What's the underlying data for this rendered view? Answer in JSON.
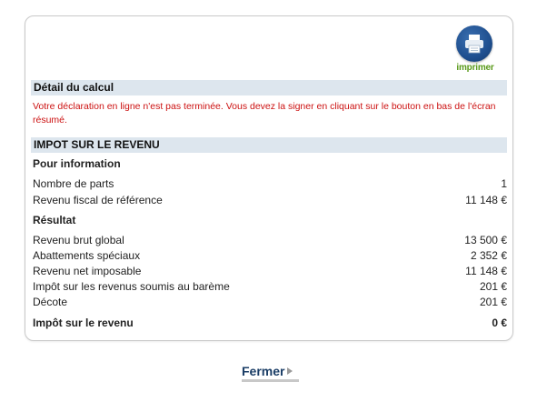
{
  "print": {
    "label": "imprimer",
    "icon": "printer-icon"
  },
  "detail": {
    "title": "Détail du calcul",
    "warning": "Votre déclaration en ligne n'est pas terminée. Vous devez la signer en cliquant sur le bouton en bas de l'écran résumé."
  },
  "impot": {
    "title": "IMPOT SUR LE REVENU",
    "info_heading": "Pour information",
    "info_rows": [
      {
        "label": "Nombre de parts",
        "value": "1"
      },
      {
        "label": "Revenu fiscal de référence",
        "value": "11 148 €"
      }
    ],
    "result_heading": "Résultat",
    "result_rows": [
      {
        "label": "Revenu brut global",
        "value": "13 500 €"
      },
      {
        "label": "Abattements spéciaux",
        "value": "2 352 €"
      },
      {
        "label": "Revenu net imposable",
        "value": "11 148 €"
      },
      {
        "label": "Impôt sur les revenus soumis au barème",
        "value": "201 €"
      },
      {
        "label": "Décote",
        "value": "201 €"
      }
    ],
    "total": {
      "label": "Impôt sur le revenu",
      "value": "0 €"
    }
  },
  "footer": {
    "close_label": "Fermer"
  },
  "colors": {
    "section_bg": "#dde6ee",
    "warning": "#cc1111",
    "print_label": "#5a9a1a",
    "print_circle": "#1f4f8f",
    "close_text": "#1a3d66"
  }
}
